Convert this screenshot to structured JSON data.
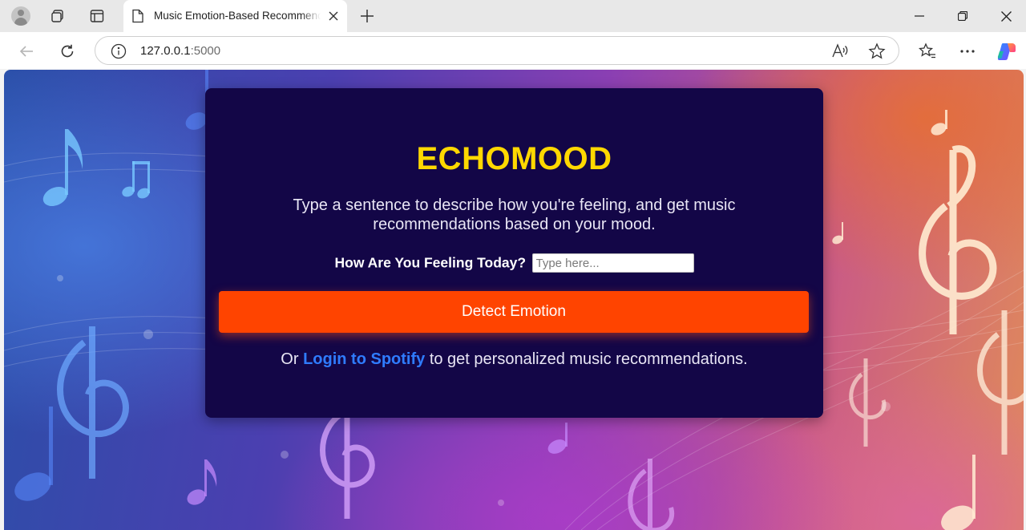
{
  "browser": {
    "tab_title": "Music Emotion-Based Recommendation",
    "url_host": "127.0.0.1",
    "url_port": ":5000"
  },
  "icons": {
    "profile": "profile-avatar-icon",
    "workspaces": "tab-actions-icon",
    "vertical_tabs": "vertical-tabs-icon",
    "page": "page-favicon-icon",
    "close": "close-icon",
    "new_tab": "plus-icon",
    "back": "back-arrow-icon",
    "reload": "reload-icon",
    "info": "info-icon",
    "read_aloud": "read-aloud-icon",
    "favorite": "star-icon",
    "favorites": "favorites-icon",
    "more": "more-icon",
    "copilot": "copilot-icon"
  },
  "page": {
    "brand": "ECHOMOOD",
    "subtitle": "Type a sentence to describe how you're feeling, and get music recommendations based on your mood.",
    "feeling_label": "How Are You Feeling Today?",
    "feeling_placeholder": "Type here...",
    "detect_button": "Detect Emotion",
    "spotify_prefix": "Or ",
    "spotify_link": "Login to Spotify",
    "spotify_suffix": " to get personalized music recommendations."
  },
  "colors": {
    "card_bg": "#130647",
    "brand": "#ffd800",
    "button": "#ff4400",
    "link": "#2f7cff"
  }
}
